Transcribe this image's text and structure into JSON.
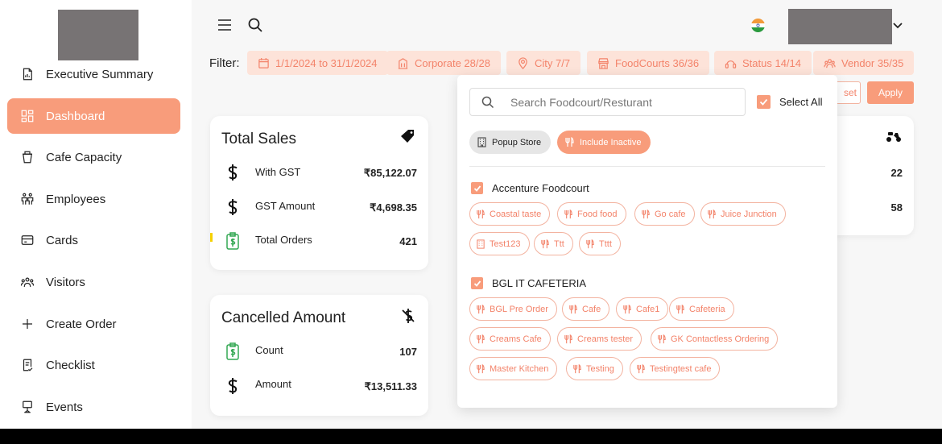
{
  "colors": {
    "accent": "#f89c7b",
    "accent_text": "#f3836a",
    "chip_bg": "#fde3d9"
  },
  "sidebar": {
    "items": [
      {
        "label": "Executive Summary",
        "icon": "report-icon"
      },
      {
        "label": "Dashboard",
        "icon": "dashboard-icon",
        "active": true
      },
      {
        "label": "Cafe Capacity",
        "icon": "cup-icon"
      },
      {
        "label": "Employees",
        "icon": "people-icon"
      },
      {
        "label": "Cards",
        "icon": "card-icon"
      },
      {
        "label": "Visitors",
        "icon": "visitors-icon"
      },
      {
        "label": "Create Order",
        "icon": "plus-icon"
      },
      {
        "label": "Checklist",
        "icon": "checklist-icon"
      },
      {
        "label": "Events",
        "icon": "events-icon"
      }
    ]
  },
  "filters": {
    "label": "Filter:",
    "chips": [
      {
        "label": "1/1/2024 to 31/1/2024",
        "icon": "calendar-icon"
      },
      {
        "label": "Corporate 28/28",
        "icon": "building-icon"
      },
      {
        "label": "City 7/7",
        "icon": "location-icon"
      },
      {
        "label": "FoodCourts 36/36",
        "icon": "store-icon"
      },
      {
        "label": "Status 14/14",
        "icon": "status-icon"
      },
      {
        "label": "Vendor 35/35",
        "icon": "vendor-icon"
      }
    ],
    "reset_label": "set",
    "apply_label": "Apply"
  },
  "total_sales": {
    "title": "Total Sales",
    "rows": [
      {
        "label": "With GST",
        "value": "₹85,122.07"
      },
      {
        "label": "GST Amount",
        "value": "₹4,698.35"
      },
      {
        "label": "Total Orders",
        "value": "421"
      }
    ]
  },
  "cancelled": {
    "title": "Cancelled Amount",
    "rows": [
      {
        "label": "Count",
        "value": "107"
      },
      {
        "label": "Amount",
        "value": "₹13,511.33"
      }
    ]
  },
  "right_card": {
    "title_fragment": "s",
    "values": [
      "22",
      "58"
    ]
  },
  "panel": {
    "search_placeholder": "Search Foodcourt/Resturant",
    "select_all": "Select All",
    "toggle_popup": "Popup Store",
    "toggle_inactive": "Include Inactive",
    "groups": [
      {
        "name": "Accenture Foodcourt",
        "items": [
          "Coastal taste",
          "Food food",
          "Go cafe",
          "Juice Junction",
          "Test123",
          "Ttt",
          "Tttt"
        ]
      },
      {
        "name": "BGL IT CAFETERIA",
        "items": [
          "BGL Pre Order",
          "Cafe",
          "Cafe1",
          "Cafeteria",
          "Creams Cafe",
          "Creams tester",
          "GK Contactless Ordering",
          "Master Kitchen",
          "Testing",
          "Testingtest cafe"
        ]
      }
    ]
  }
}
